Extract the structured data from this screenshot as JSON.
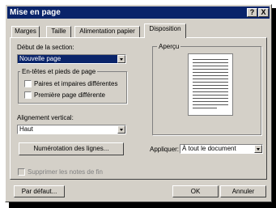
{
  "window": {
    "title": "Mise en page",
    "help_btn": "?",
    "close_btn": "X"
  },
  "tabs": [
    {
      "label": "Marges"
    },
    {
      "label": "Taille"
    },
    {
      "label": "Alimentation papier"
    },
    {
      "label": "Disposition"
    }
  ],
  "section": {
    "label": "Début de la section:",
    "value": "Nouvelle page"
  },
  "headers_group": {
    "title": "En-têtes et pieds de page",
    "opt1": "Paires et impaires différentes",
    "opt2": "Première page différente"
  },
  "vertical": {
    "label": "Alignement vertical:",
    "value": "Haut"
  },
  "line_numbers_btn": "Numérotation des lignes...",
  "suppress": "Supprimer les notes de fin",
  "preview": {
    "title": "Aperçu"
  },
  "apply": {
    "label": "Appliquer:",
    "value": "À tout le document"
  },
  "buttons": {
    "default": "Par défaut...",
    "ok": "OK",
    "cancel": "Annuler"
  }
}
